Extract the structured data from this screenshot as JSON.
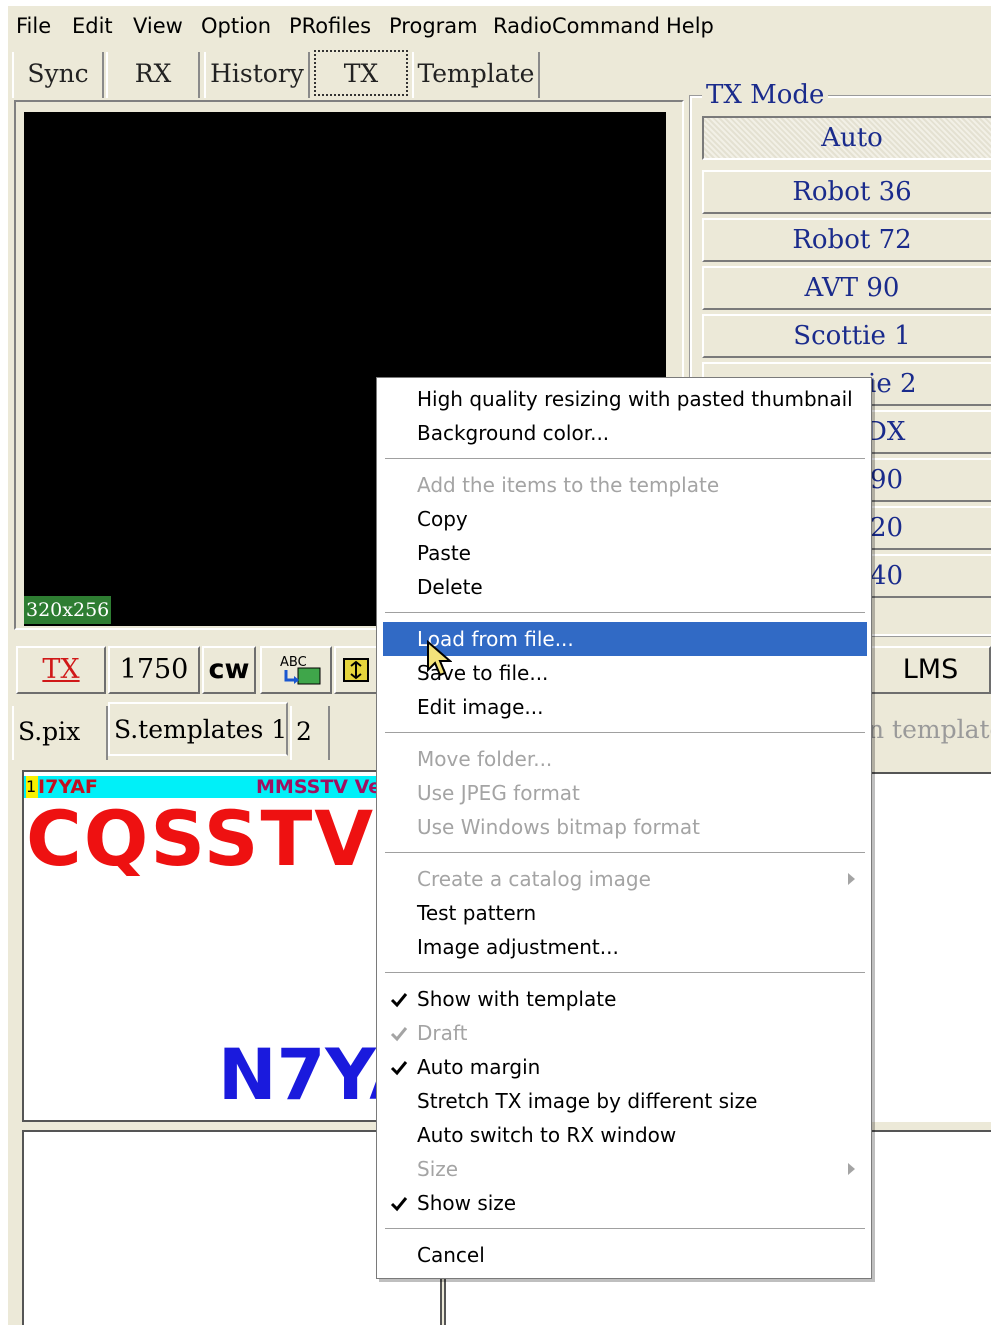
{
  "menubar": [
    "File",
    "Edit",
    "View",
    "Option",
    "PRofiles",
    "Program",
    "RadioCommand",
    "Help"
  ],
  "tabs": [
    {
      "label": "Sync",
      "active": false
    },
    {
      "label": "RX",
      "active": false
    },
    {
      "label": "History",
      "active": false
    },
    {
      "label": "TX",
      "active": true
    },
    {
      "label": "Template",
      "active": false
    }
  ],
  "image_panel": {
    "size_label": "320x256"
  },
  "tx_mode": {
    "title": "TX Mode",
    "buttons": [
      "Auto",
      "Robot 36",
      "Robot 72",
      "AVT 90",
      "Scottie 1",
      "ie 2",
      "DX",
      "90",
      "20",
      "40"
    ],
    "selected": "Auto"
  },
  "button_row": {
    "tx": "TX",
    "freq": "1750",
    "cw": "cw",
    "lms": "LMS"
  },
  "lower_tabs": [
    "S.pix",
    "S.templates 1",
    "2"
  ],
  "lower_right_label": "n template",
  "thumbnail": {
    "number": "1",
    "callsign_small": "I7YAF",
    "software_small": "MMSSTV Ve",
    "big_text": "CQSSTV",
    "callsign_big": "N7YA"
  },
  "context_menu": {
    "items": [
      {
        "label": "High quality resizing with pasted thumbnail",
        "enabled": true
      },
      {
        "label": "Background color...",
        "enabled": true
      },
      {
        "separator": true
      },
      {
        "label": "Add the items to the template",
        "enabled": false
      },
      {
        "label": "Copy",
        "enabled": true
      },
      {
        "label": "Paste",
        "enabled": true
      },
      {
        "label": "Delete",
        "enabled": true
      },
      {
        "separator": true
      },
      {
        "label": "Load from file...",
        "enabled": true,
        "highlighted": true
      },
      {
        "label": "Save to file...",
        "enabled": true
      },
      {
        "label": "Edit image...",
        "enabled": true
      },
      {
        "separator": true
      },
      {
        "label": "Move folder...",
        "enabled": false
      },
      {
        "label": "Use JPEG format",
        "enabled": false
      },
      {
        "label": "Use Windows bitmap format",
        "enabled": false
      },
      {
        "separator": true
      },
      {
        "label": "Create a catalog image",
        "enabled": false,
        "submenu": true
      },
      {
        "label": "Test pattern",
        "enabled": true
      },
      {
        "label": "Image adjustment...",
        "enabled": true
      },
      {
        "separator": true
      },
      {
        "label": "Show with template",
        "enabled": true,
        "checked": true
      },
      {
        "label": "Draft",
        "enabled": false,
        "checked": true
      },
      {
        "label": "Auto margin",
        "enabled": true,
        "checked": true
      },
      {
        "label": "Stretch TX image by different size",
        "enabled": true
      },
      {
        "label": "Auto switch to RX window",
        "enabled": true
      },
      {
        "label": "Size",
        "enabled": false,
        "submenu": true
      },
      {
        "label": "Show size",
        "enabled": true,
        "checked": true
      },
      {
        "separator": true
      },
      {
        "label": "Cancel",
        "enabled": true
      }
    ]
  },
  "colors": {
    "highlight": "#316ac5",
    "mode_text": "#1a2b8c",
    "cqsstv": "#ee1111",
    "callsign": "#1a1add",
    "thumb_bar": "#00f0f8"
  }
}
